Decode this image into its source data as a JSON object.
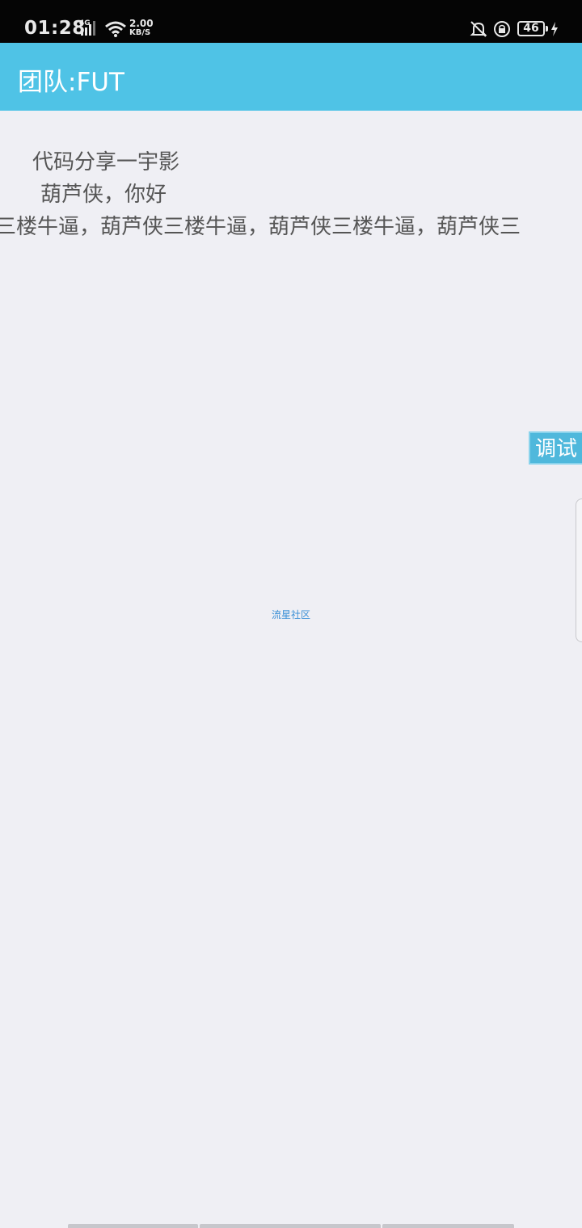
{
  "status_bar": {
    "time": "01:28",
    "network_type": "4G",
    "speed_value": "2.00",
    "speed_unit": "KB/S",
    "battery_level": "46",
    "icons": [
      "signal-icon",
      "wifi-icon",
      "bell-muted-icon",
      "rotation-lock-icon",
      "battery-icon",
      "charging-icon"
    ]
  },
  "app_bar": {
    "title": "团队:FUT",
    "background_color": "#4fc3e6"
  },
  "content": {
    "line1": "代码分享一宇影",
    "line2": "葫芦侠，你好",
    "marquee": "三楼牛逼，葫芦侠三楼牛逼，葫芦侠三楼牛逼，葫芦侠三"
  },
  "debug_button": {
    "label": "调试"
  },
  "footer": {
    "link_text": "流星社区"
  }
}
